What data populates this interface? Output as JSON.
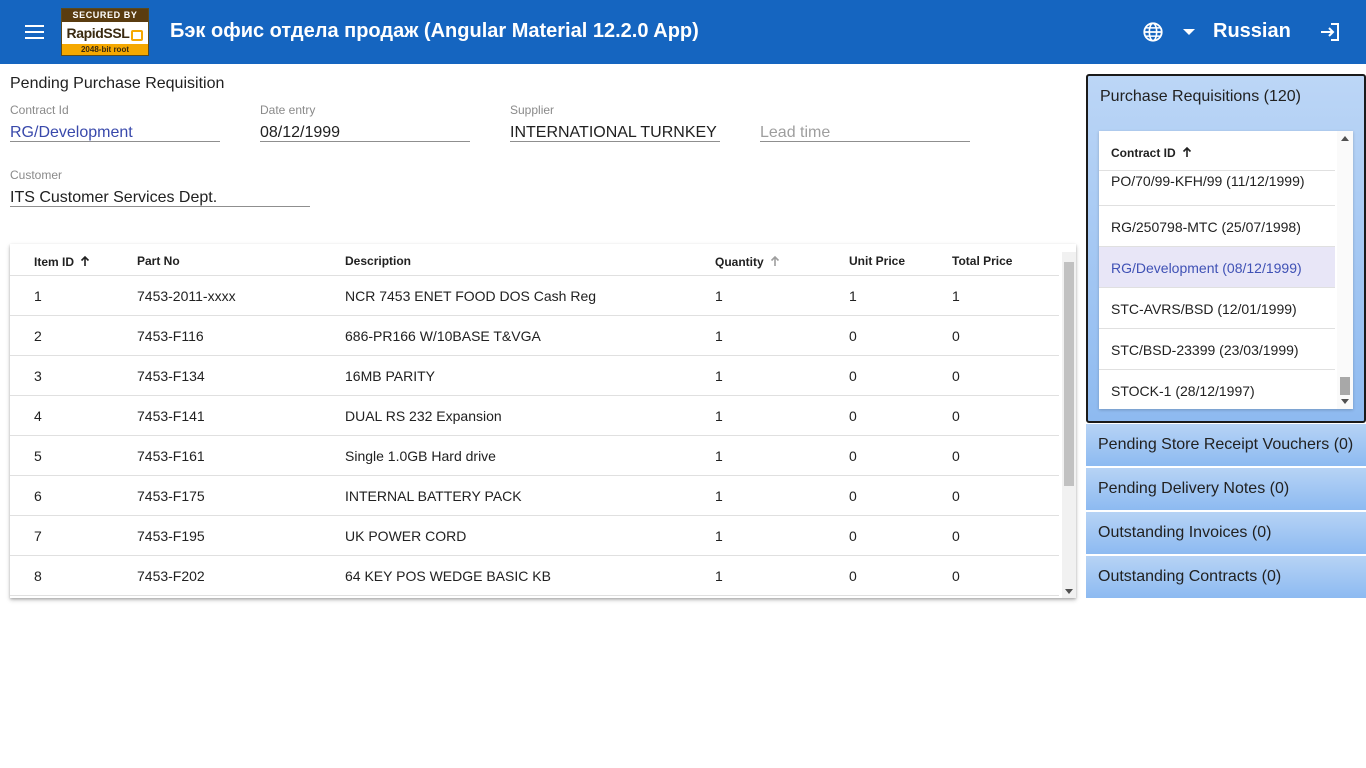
{
  "header": {
    "title": "Бэк офис отдела продаж (Angular Material 12.2.0 App)",
    "language": "Russian",
    "ssl_badge": {
      "top": "SECURED BY",
      "brand": "RapidSSL",
      "bottom": "2048-bit root"
    },
    "icons": {
      "menu": "menu-icon",
      "language": "globe-icon",
      "dropdown": "caret-down-icon",
      "logout": "exit-icon"
    },
    "colors": {
      "toolbar": "#1565c0",
      "badge_accent": "#f5a800"
    }
  },
  "form": {
    "title": "Pending Purchase Requisition",
    "contract_id": {
      "label": "Contract Id",
      "value": "RG/Development"
    },
    "date_entry": {
      "label": "Date entry",
      "value": "08/12/1999"
    },
    "supplier": {
      "label": "Supplier",
      "value": "INTERNATIONAL TURNKEY SYSTEMS"
    },
    "lead_time": {
      "placeholder": "Lead time"
    },
    "customer": {
      "label": "Customer",
      "value": "ITS Customer Services Dept."
    }
  },
  "items_table": {
    "columns": [
      "Item ID",
      "Part No",
      "Description",
      "Quantity",
      "Unit Price",
      "Total Price"
    ],
    "rows": [
      [
        "1",
        "7453-2011-xxxx",
        "NCR 7453 ENET FOOD DOS Cash Reg",
        "1",
        "1",
        "1"
      ],
      [
        "2",
        "7453-F116",
        "686-PR166 W/10BASE T&VGA",
        "1",
        "0",
        "0"
      ],
      [
        "3",
        "7453-F134",
        "16MB PARITY",
        "1",
        "0",
        "0"
      ],
      [
        "4",
        "7453-F141",
        "DUAL RS 232 Expansion",
        "1",
        "0",
        "0"
      ],
      [
        "5",
        "7453-F161",
        "Single 1.0GB Hard drive",
        "1",
        "0",
        "0"
      ],
      [
        "6",
        "7453-F175",
        "INTERNAL BATTERY PACK",
        "1",
        "0",
        "0"
      ],
      [
        "7",
        "7453-F195",
        "UK POWER CORD",
        "1",
        "0",
        "0"
      ],
      [
        "8",
        "7453-F202",
        "64 KEY POS WEDGE BASIC KB",
        "1",
        "0",
        "0"
      ]
    ]
  },
  "sidebar": {
    "purchase_requisitions": {
      "title": "Purchase Requisitions (120)",
      "column": "Contract ID",
      "items": [
        "PO/70/99-KFH/99 (11/12/1999)",
        "RG/250798-MTC (25/07/1998)",
        "RG/Development (08/12/1999)",
        "STC-AVRS/BSD (12/01/1999)",
        "STC/BSD-23399 (23/03/1999)",
        "STOCK-1 (28/12/1997)"
      ],
      "selected": "RG/Development (08/12/1999)"
    },
    "panels": [
      "Pending Store Receipt Vouchers (0)",
      "Pending Delivery Notes (0)",
      "Outstanding Invoices (0)",
      "Outstanding Contracts (0)"
    ]
  }
}
